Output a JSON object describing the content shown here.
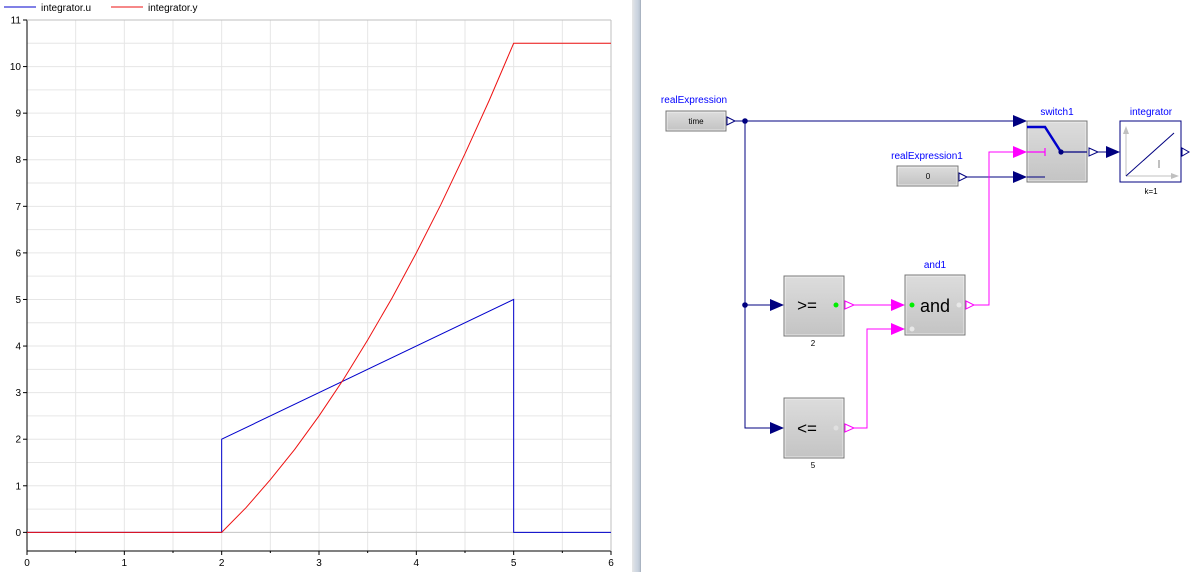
{
  "plot": {
    "chart_data": {
      "type": "line",
      "xlim": [
        0,
        6
      ],
      "ylim": [
        -0.4,
        11
      ],
      "x_ticks": [
        0,
        1,
        2,
        3,
        4,
        5,
        6
      ],
      "y_ticks": [
        0,
        1,
        2,
        3,
        4,
        5,
        6,
        7,
        8,
        9,
        10,
        11
      ],
      "grid": true,
      "legend_position": "top-left",
      "series": [
        {
          "name": "integrator.u",
          "color": "#0000cc",
          "x": [
            0,
            2,
            2,
            5,
            5,
            6
          ],
          "y": [
            0,
            0,
            2,
            5,
            0,
            0
          ]
        },
        {
          "name": "integrator.y",
          "color": "#ee1111",
          "x": [
            0,
            2,
            2.25,
            2.5,
            2.75,
            3,
            3.25,
            3.5,
            3.75,
            4,
            4.25,
            4.5,
            4.75,
            5,
            6
          ],
          "y": [
            0,
            0,
            0.53,
            1.13,
            1.78,
            2.5,
            3.28,
            4.13,
            5.03,
            6.0,
            7.03,
            8.13,
            9.28,
            10.5,
            10.5
          ]
        }
      ]
    }
  },
  "diagram": {
    "colors": {
      "real_signal": "#000080",
      "boolean_signal": "#ff00ff",
      "label": "#0000ff",
      "block_fill": "#c8c8c8"
    },
    "blocks": {
      "realExpression": {
        "name": "realExpression",
        "value": "time"
      },
      "realExpression1": {
        "name": "realExpression1",
        "value": "0"
      },
      "switch1": {
        "name": "switch1"
      },
      "integrator": {
        "name": "integrator",
        "param": "k=1",
        "icon": "integrator-icon"
      },
      "and1": {
        "name": "and1",
        "symbol": "and"
      },
      "greater_equal": {
        "symbol": ">=",
        "param": "2"
      },
      "less_equal": {
        "symbol": "<=",
        "param": "5"
      }
    }
  }
}
